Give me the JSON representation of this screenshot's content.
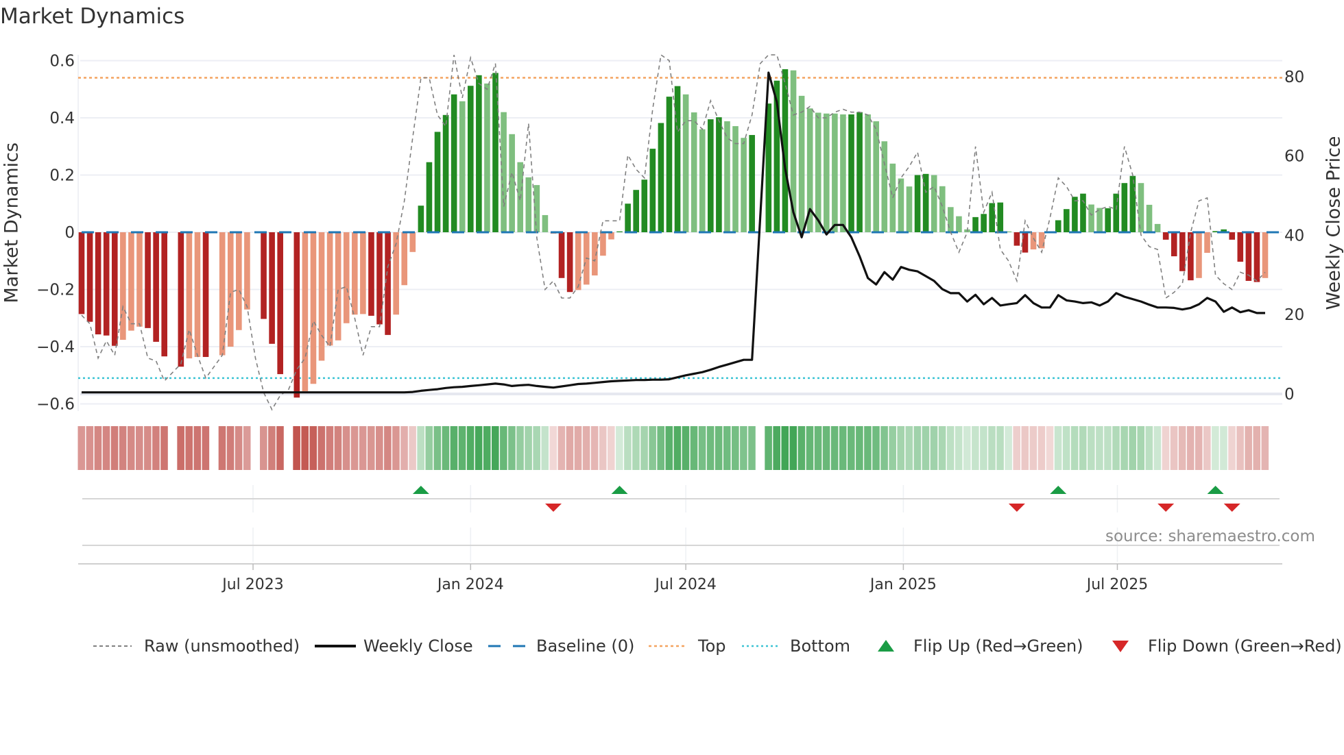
{
  "chart_data": {
    "type": "bar",
    "title": "Market Dynamics",
    "ylabel": "Market Dynamics",
    "y2label": "Weekly Close Price",
    "source": "source: sharemaestro.com",
    "start_date": "2023-02-06",
    "frequency": "weekly",
    "ylim": [
      -0.62,
      0.62
    ],
    "y2lim": [
      -1,
      85
    ],
    "yticks": [
      "0.6",
      "0.4",
      "0.2",
      "0",
      "−0.2",
      "−0.4",
      "−0.6"
    ],
    "ytick_values": [
      0.6,
      0.4,
      0.2,
      0,
      -0.2,
      -0.4,
      -0.6
    ],
    "y2ticks": [
      "80",
      "60",
      "40",
      "20",
      "0"
    ],
    "y2tick_values": [
      80,
      60,
      40,
      20,
      0
    ],
    "xticks": [
      {
        "label": "Jul 2023",
        "date": "2023-07-01"
      },
      {
        "label": "Jan 2024",
        "date": "2024-01-01"
      },
      {
        "label": "Jul 2024",
        "date": "2024-07-01"
      },
      {
        "label": "Jan 2025",
        "date": "2025-01-01"
      },
      {
        "label": "Jul 2025",
        "date": "2025-07-01"
      }
    ],
    "thresholds": {
      "top": 0.54,
      "bottom": -0.51,
      "baseline": 0
    },
    "strength_codes": "DDDDDLLLDDD-DLLD-LLLL-DDD-DLLLLLLLLDDDLLLDDDDDLDDLDLLLLLLLDDLLLLLDDDDDDDDLLLDDLLLD-DDDLLLLLLLDDLLLLLLDDLLLLLDDDDLDDLLLDDDDLLDDDDLLLDDDDLLDDDDDDL",
    "smoothed": [
      -0.286,
      -0.313,
      -0.357,
      -0.361,
      -0.397,
      -0.376,
      -0.344,
      -0.33,
      -0.335,
      -0.383,
      -0.434,
      null,
      -0.47,
      -0.441,
      -0.436,
      -0.436,
      null,
      -0.43,
      -0.4,
      -0.342,
      -0.27,
      null,
      -0.303,
      -0.39,
      -0.496,
      null,
      -0.578,
      -0.556,
      -0.53,
      -0.449,
      -0.396,
      -0.378,
      -0.318,
      -0.288,
      -0.286,
      -0.292,
      -0.322,
      -0.359,
      -0.288,
      -0.185,
      -0.069,
      0.093,
      0.245,
      0.351,
      0.41,
      0.482,
      0.458,
      0.512,
      0.549,
      0.52,
      0.557,
      0.42,
      0.343,
      0.245,
      0.192,
      0.165,
      0.06,
      -0.005,
      -0.16,
      -0.209,
      -0.202,
      -0.183,
      -0.151,
      -0.082,
      -0.025,
      0.003,
      0.1,
      0.148,
      0.184,
      0.292,
      0.382,
      0.474,
      0.511,
      0.482,
      0.419,
      0.36,
      0.395,
      0.402,
      0.388,
      0.371,
      0.33,
      0.34,
      null,
      0.45,
      0.53,
      0.57,
      0.566,
      0.477,
      0.433,
      0.418,
      0.415,
      0.415,
      0.412,
      0.412,
      0.42,
      0.412,
      0.388,
      0.318,
      0.24,
      0.188,
      0.16,
      0.2,
      0.204,
      0.2,
      0.161,
      0.088,
      0.056,
      0.01,
      0.053,
      0.064,
      0.102,
      0.104,
      0.003,
      -0.047,
      -0.071,
      -0.06,
      -0.056,
      -0.003,
      0.042,
      0.081,
      0.124,
      0.135,
      0.097,
      0.085,
      0.084,
      0.135,
      0.172,
      0.197,
      0.172,
      0.096,
      0.029,
      -0.026,
      -0.084,
      -0.136,
      -0.168,
      -0.16,
      -0.072,
      0.004,
      0.01,
      -0.026,
      -0.103,
      -0.17,
      -0.174,
      -0.16
    ],
    "raw": [
      -0.29,
      -0.32,
      -0.44,
      -0.38,
      -0.43,
      -0.26,
      -0.32,
      -0.32,
      -0.44,
      -0.45,
      -0.52,
      -0.49,
      -0.46,
      -0.34,
      -0.43,
      -0.51,
      -0.47,
      -0.43,
      -0.21,
      -0.2,
      -0.26,
      -0.44,
      -0.56,
      -0.62,
      -0.57,
      -0.55,
      -0.48,
      -0.44,
      -0.31,
      -0.36,
      -0.4,
      -0.2,
      -0.19,
      -0.3,
      -0.43,
      -0.33,
      -0.33,
      -0.12,
      -0.04,
      0.11,
      0.33,
      0.54,
      0.54,
      0.41,
      0.37,
      0.62,
      0.47,
      0.61,
      0.52,
      0.5,
      0.59,
      0.09,
      0.21,
      0.11,
      0.38,
      -0.02,
      -0.2,
      -0.17,
      -0.23,
      -0.23,
      -0.19,
      -0.09,
      -0.1,
      0.04,
      0.04,
      0.04,
      0.27,
      0.22,
      0.19,
      0.43,
      0.62,
      0.6,
      0.35,
      0.39,
      0.39,
      0.36,
      0.46,
      0.39,
      0.33,
      0.31,
      0.31,
      0.41,
      0.59,
      0.62,
      0.62,
      0.52,
      0.41,
      0.42,
      0.44,
      0.4,
      0.4,
      0.42,
      0.43,
      0.42,
      0.42,
      0.41,
      0.36,
      0.24,
      0.12,
      0.19,
      0.23,
      0.28,
      0.14,
      0.16,
      0.09,
      0.0,
      -0.07,
      0.0,
      0.3,
      0.07,
      0.14,
      -0.06,
      -0.1,
      -0.17,
      0.04,
      -0.02,
      -0.07,
      0.05,
      0.19,
      0.16,
      0.11,
      0.11,
      0.06,
      0.08,
      0.09,
      0.08,
      0.3,
      0.2,
      -0.01,
      -0.05,
      -0.06,
      -0.23,
      -0.21,
      -0.18,
      0.0,
      0.11,
      0.12,
      -0.15,
      -0.18,
      -0.2,
      -0.14,
      -0.15,
      -0.17,
      -0.14
    ],
    "weekly_close": [
      0.4,
      0.4,
      0.4,
      0.4,
      0.4,
      0.4,
      0.4,
      0.4,
      0.4,
      0.4,
      0.4,
      0.4,
      0.4,
      0.4,
      0.4,
      0.4,
      0.4,
      0.4,
      0.4,
      0.4,
      0.4,
      0.4,
      0.4,
      0.4,
      0.4,
      0.4,
      0.4,
      0.4,
      0.4,
      0.4,
      0.4,
      0.4,
      0.4,
      0.4,
      0.4,
      0.4,
      0.4,
      0.4,
      0.4,
      0.4,
      0.5,
      0.8,
      1.0,
      1.2,
      1.5,
      1.7,
      1.8,
      2.0,
      2.2,
      2.4,
      2.6,
      2.4,
      2.0,
      2.2,
      2.3,
      2.0,
      1.8,
      1.6,
      1.9,
      2.2,
      2.5,
      2.6,
      2.8,
      3.0,
      3.2,
      3.3,
      3.4,
      3.5,
      3.5,
      3.6,
      3.6,
      3.7,
      4.2,
      4.7,
      5.1,
      5.5,
      6.1,
      6.8,
      7.4,
      8.0,
      8.6,
      8.6,
      null,
      81,
      73.6,
      56.8,
      45.8,
      39.5,
      46.6,
      43.8,
      40.2,
      42.6,
      42.6,
      39.5,
      34.7,
      29.2,
      27.6,
      30.7,
      28.8,
      32.0,
      31.3,
      30.9,
      29.7,
      28.5,
      26.4,
      25.4,
      25.4,
      23.3,
      25.0,
      22.6,
      24.2,
      22.3,
      22.6,
      22.9,
      24.9,
      22.9,
      21.8,
      21.8,
      24.9,
      23.6,
      23.3,
      22.9,
      23.1,
      22.3,
      23.3,
      25.4,
      24.5,
      23.9,
      23.3,
      22.5,
      21.8,
      21.8,
      21.7,
      21.3,
      21.7,
      22.6,
      24.2,
      23.3,
      20.7,
      21.8,
      20.6,
      21.1,
      20.4,
      20.4
    ],
    "flip_up_weeks": [
      41,
      65,
      118,
      137
    ],
    "flip_down_weeks": [
      57,
      113,
      131,
      139
    ],
    "legend_position": "bottom",
    "legend": {
      "raw": "Raw (unsmoothed)",
      "close": "Weekly Close",
      "baseline": "Baseline (0)",
      "top": "Top",
      "bottom": "Bottom",
      "flip_up": "Flip Up (Red→Green)",
      "flip_down": "Flip Down (Green→Red)"
    },
    "colors": {
      "pos_strong": "#228b22",
      "pos_weak": "#7fbf7f",
      "neg_strong": "#b22222",
      "neg_weak": "#e9967a",
      "raw": "#808080",
      "close": "#111111",
      "baseline": "#1f77b4",
      "top": "#f4a460",
      "bottom": "#3cc4d4",
      "flip_up": "#1a9c45",
      "flip_down": "#d62728",
      "strip_pos": "#3aa24f",
      "strip_neg": "#c0504a"
    }
  }
}
